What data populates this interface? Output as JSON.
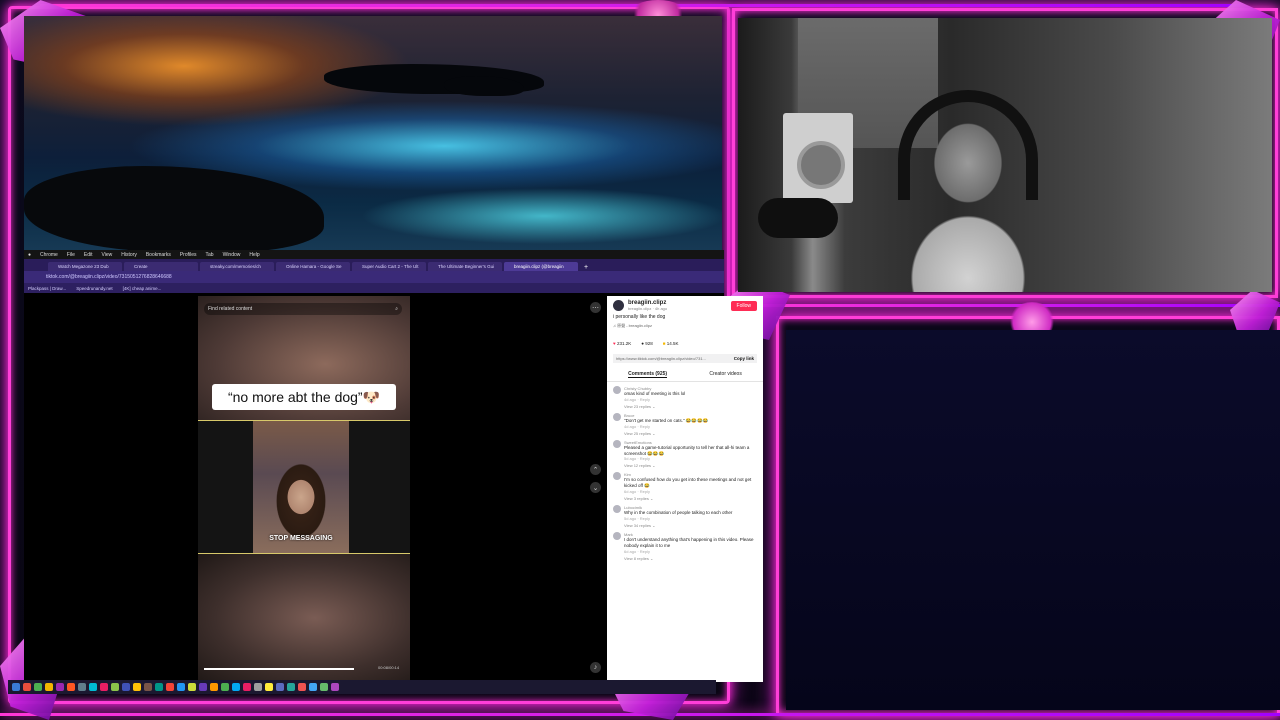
{
  "mac_menu": [
    "Chrome",
    "File",
    "Edit",
    "View",
    "History",
    "Bookmarks",
    "Profiles",
    "Tab",
    "Window",
    "Help"
  ],
  "tabs": [
    {
      "label": "Watch Megazone 23 Dub"
    },
    {
      "label": "Create"
    },
    {
      "label": "streaky.com/memories/ch"
    },
    {
      "label": "Online Hamara - Google Se"
    },
    {
      "label": "Super Audio Cart 2 - The Ult"
    },
    {
      "label": "The Ultimate Beginner's Gui"
    },
    {
      "label": "breagiin.clipz (@breagiin"
    }
  ],
  "url": "tiktok.com/@breagiin.clipz/video/7315051276828646688",
  "bookmarks": [
    "Plackpass | Draw...",
    "Speedrunandy.net",
    "[4K] cheap anime..."
  ],
  "video": {
    "search_placeholder": "Find related content",
    "caption": "“no more abt the dog”🐶",
    "overlay_text": "STOP MESSAGING",
    "time": "00:08/00:14"
  },
  "post": {
    "username": "breagiin.clipz",
    "subline": "breagiin.clipz · 4h ago",
    "follow": "Follow",
    "description": "i personally like the dog",
    "sound": "♫ 原聲 - breagiin.clipz",
    "stats": [
      "231.2K",
      "928",
      "14.5K"
    ],
    "link": "https://www.tiktok.com/@breagiin.clipz/video/731...",
    "copy_link": "Copy link",
    "tab_comments": "Comments (925)",
    "tab_creator": "Creator videos"
  },
  "comments": [
    {
      "name": "Christy Chubby",
      "text": "omas kind of meeting is this lol",
      "time": "4d ago · Reply",
      "replies": "View 23 replies ⌄"
    },
    {
      "name": "Bruce",
      "text": "\"Don't get me started on cats.\" 😂😂😂😂",
      "time": "4d ago · Reply",
      "replies": "View 25 replies ⌄"
    },
    {
      "name": "SweetEmotions",
      "text": "Pleased a game-tutorial opportunity to tell her that all-hi team a screenshot 😂😂😂",
      "time": "5d ago · Reply",
      "replies": "View 12 replies ⌄"
    },
    {
      "name": "Kim",
      "text": "I'm so confused how do you get into these meetings and not get kicked off 😂",
      "time": "6d ago · Reply",
      "replies": "View 3 replies ⌄"
    },
    {
      "name": "Lubocimlk",
      "text": "Why in the combination of people talking to each other",
      "time": "5d ago · Reply",
      "replies": "View 34 replies ⌄"
    },
    {
      "name": "Mark",
      "text": "I don't understand anything that's happening in this video. Please nobody explain it to me",
      "time": "6d ago · Reply",
      "replies": "View 8 replies ⌄"
    }
  ],
  "colors": {
    "neon": "#ff3fd8",
    "tiktok_red": "#fe2c55",
    "browser_purple": "#3a2a78"
  }
}
